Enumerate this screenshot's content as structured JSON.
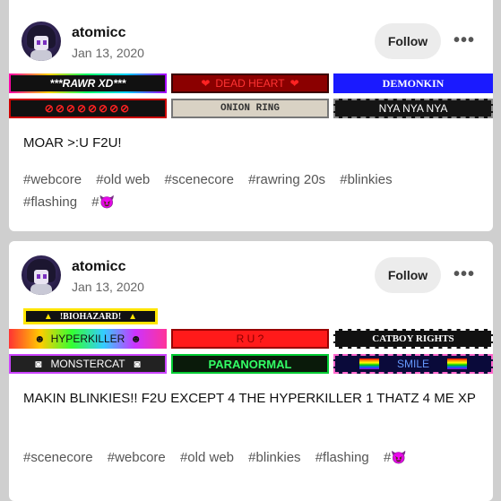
{
  "posts": [
    {
      "username": "atomicc",
      "date": "Jan 13, 2020",
      "follow_label": "Follow",
      "more_label": "•••",
      "blinkies": [
        "***RAWR XD***",
        "DEAD HEART",
        "DEMONKIN",
        "⊘⊘⊘⊘⊘⊘⊘⊘",
        "ONION RING",
        "NYA NYA NYA"
      ],
      "caption": "MOAR >:U F2U!",
      "tags": [
        "#webcore",
        "#old web",
        "#scenecore",
        "#rawring 20s",
        "#blinkies",
        "#flashing",
        "#"
      ]
    },
    {
      "username": "atomicc",
      "date": "Jan 13, 2020",
      "follow_label": "Follow",
      "more_label": "•••",
      "blinkies": [
        "!BIOHAZARD!",
        "HYPERKILLER",
        "R U ?",
        "CATBOY RIGHTS",
        "MONSTERCAT",
        "PARANORMAL",
        "SMILE"
      ],
      "caption": "MAKIN BLINKIES!! F2U EXCEPT 4 THE HYPERKILLER 1 THATZ 4 ME XP",
      "tags": [
        "#scenecore",
        "#webcore",
        "#old web",
        "#blinkies",
        "#flashing",
        "#"
      ]
    }
  ],
  "colors": {
    "background": "#cfcfcf",
    "card": "#ffffff",
    "follow_bg": "#ececec"
  },
  "icons": [
    "avatar",
    "more-icon",
    "devil-emoji-icon"
  ]
}
